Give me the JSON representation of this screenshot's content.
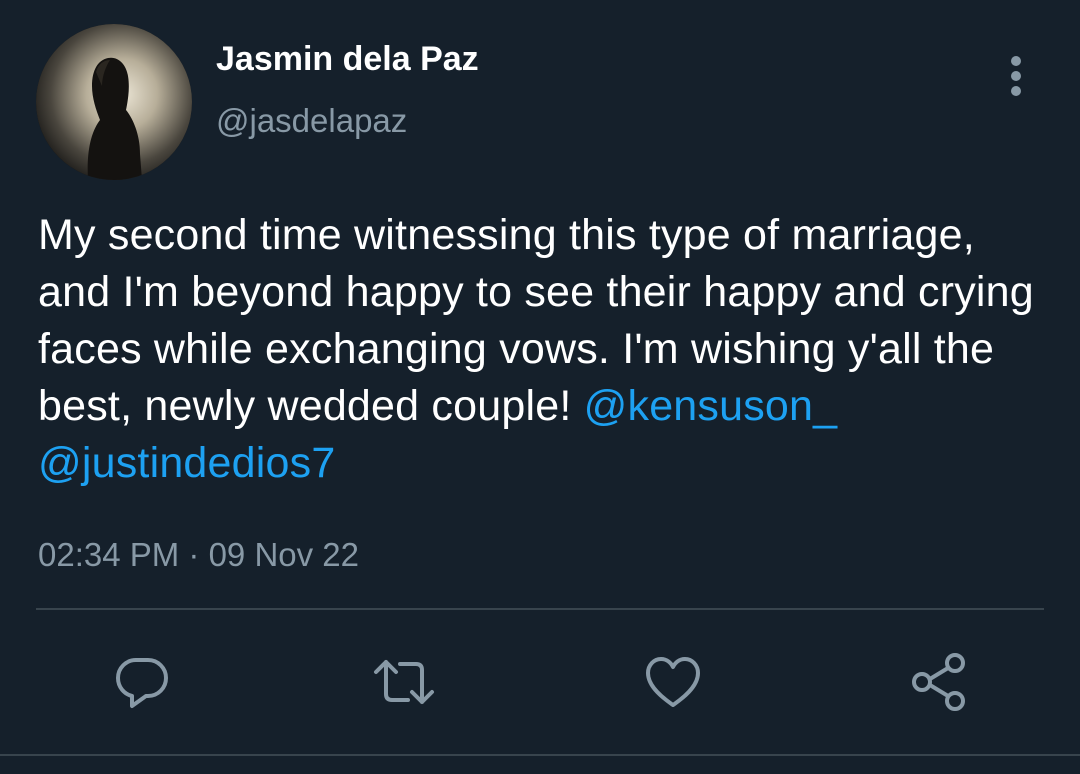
{
  "tweet": {
    "author": {
      "display_name": "Jasmin dela Paz",
      "handle": "@jasdelapaz",
      "avatar_icon": "avatar-silhouette"
    },
    "text": {
      "segments": [
        "My second time witnessing this type of marriage, and I'm beyond happy to see their happy and crying faces while exchanging vows. I'm wishing y'all the best, newly wedded couple! "
      ],
      "mentions": [
        "@kensuson_",
        "@justindedios7"
      ]
    },
    "timestamp": {
      "time": "02:34 PM",
      "separator": " · ",
      "date": "09 Nov 22"
    },
    "actions": {
      "reply_icon": "reply-icon",
      "retweet_icon": "retweet-icon",
      "like_icon": "heart-icon",
      "share_icon": "share-icon",
      "more_icon": "more-vertical-icon"
    }
  },
  "colors": {
    "background": "#15202b",
    "text": "#ffffff",
    "secondary_text": "#8899a6",
    "link": "#1da1f2",
    "divider": "#38444d"
  }
}
